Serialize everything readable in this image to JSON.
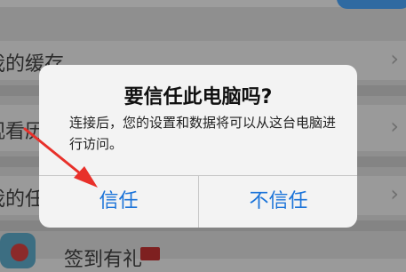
{
  "background_list": {
    "items": [
      {
        "label": "我的缓存"
      },
      {
        "label": "观看历"
      },
      {
        "label": "我的任"
      },
      {
        "label": "签到有礼"
      }
    ],
    "chevron": "›",
    "badge_text": "■"
  },
  "dialog": {
    "title": "要信任此电脑吗?",
    "message": "连接后，您的设置和数据将可以从这台电脑进行访问。",
    "trust_label": "信任",
    "distrust_label": "不信任"
  },
  "annotation": {
    "arrow_icon": "red-arrow-icon",
    "arrow_color": "#e8302a"
  },
  "colors": {
    "accent": "#1a73d9"
  }
}
